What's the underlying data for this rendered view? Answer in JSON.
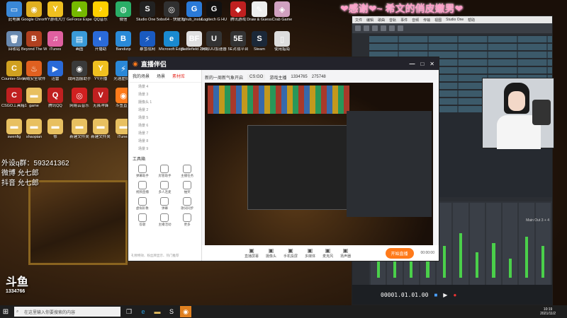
{
  "desktop": {
    "icons": [
      {
        "label": "此电脑",
        "color": "#3a88d8",
        "glyph": "▭"
      },
      {
        "label": "Google Chrome",
        "color": "#e0b020",
        "glyph": "◉"
      },
      {
        "label": "YY游戏大厅",
        "color": "#f0c020",
        "glyph": "Y"
      },
      {
        "label": "GeForce Experience",
        "color": "#76b900",
        "glyph": "▲"
      },
      {
        "label": "QQ音乐",
        "color": "#ffd000",
        "glyph": "♪"
      },
      {
        "label": "微信",
        "color": "#2aae67",
        "glyph": "◍"
      },
      {
        "label": "Studio One 5",
        "color": "#222",
        "glyph": "S"
      },
      {
        "label": "obs64 - 快捷方式",
        "color": "#303030",
        "glyph": "◎"
      },
      {
        "label": "lghub_instal...",
        "color": "#2a7ad8",
        "glyph": "G"
      },
      {
        "label": "Logitech G HUB",
        "color": "#111",
        "glyph": "G"
      },
      {
        "label": "腾讯游戏",
        "color": "#c02020",
        "glyph": "◆"
      },
      {
        "label": "Draw & Guess",
        "color": "#eee",
        "glyph": "✎"
      },
      {
        "label": "Crab Game",
        "color": "#d0a0c0",
        "glyph": "◈"
      },
      {
        "label": "回收站",
        "color": "#6a8ab0",
        "glyph": "🗑"
      },
      {
        "label": "Beyond The Wire Soun...",
        "color": "#b04020",
        "glyph": "B"
      },
      {
        "label": "iTunes",
        "color": "#e060a0",
        "glyph": "♫"
      },
      {
        "label": "画图",
        "color": "#3a9ad8",
        "glyph": "▤"
      },
      {
        "label": "开播助",
        "color": "#2a6ad8",
        "glyph": "◐"
      },
      {
        "label": "Bandizip",
        "color": "#2a8ad8",
        "glyph": "B"
      },
      {
        "label": "暴雪战网",
        "color": "#1a5ac0",
        "glyph": "⚡"
      },
      {
        "label": "Microsoft Edge",
        "color": "#1a8ad0",
        "glyph": "e"
      },
      {
        "label": "Battlefield 2042 Open...",
        "color": "#e0e0e0",
        "glyph": "BF"
      },
      {
        "label": "网易UU加速器",
        "color": "#333",
        "glyph": "U"
      },
      {
        "label": "5E对战平台",
        "color": "#333",
        "glyph": "5E"
      },
      {
        "label": "Steam",
        "color": "#1b2838",
        "glyph": "S"
      },
      {
        "label": "使用指南",
        "color": "#ddd",
        "glyph": "▯"
      },
      {
        "label": "Counter-Strike Global Off...",
        "color": "#d0a020",
        "glyph": "C"
      },
      {
        "label": "火绒安全软件",
        "color": "#e06020",
        "glyph": "♨"
      },
      {
        "label": "迅雷",
        "color": "#2a6ad8",
        "glyph": "▶"
      },
      {
        "label": "战网国服助手",
        "color": "#3a3a3a",
        "glyph": "◉"
      },
      {
        "label": "YY开播",
        "color": "#f0c020",
        "glyph": "Y"
      },
      {
        "label": "光速虚拟机",
        "color": "#2a88d8",
        "glyph": "⚡"
      },
      {
        "label": "CSGO工具箱1.0.2",
        "color": "#c02020",
        "glyph": "C"
      },
      {
        "label": "game",
        "color": "#e8c060",
        "glyph": "▬"
      },
      {
        "label": "腾讯QQ",
        "color": "#c02020",
        "glyph": "Q"
      },
      {
        "label": "网易云音乐",
        "color": "#d02020",
        "glyph": "◎"
      },
      {
        "label": "无畏冲锋",
        "color": "#c02020",
        "glyph": "V"
      },
      {
        "label": "斗鱼直播",
        "color": "#ff7a1a",
        "glyph": "◉"
      },
      {
        "label": "swenfig",
        "color": "#e8c060",
        "glyph": "▬"
      },
      {
        "label": "shaopian",
        "color": "#e8c060",
        "glyph": "▬"
      },
      {
        "label": "修",
        "color": "#e8c060",
        "glyph": "▬"
      },
      {
        "label": "新建文件夹",
        "color": "#e8c060",
        "glyph": "▬"
      },
      {
        "label": "新建文件夹",
        "color": "#e8c060",
        "glyph": "▬"
      },
      {
        "label": "iTunes",
        "color": "#e8c060",
        "glyph": "▬"
      }
    ],
    "overlay": {
      "qq_line": "外设q群：593241362",
      "weibo_line": "微博    允七郎",
      "douyin_line": "抖音    允七郎"
    },
    "banner": "❤感谢❤~ 希文的俏皮嫩男❤",
    "watermark_name": "斗鱼",
    "watermark_id": "1334766"
  },
  "streamer": {
    "app_name": "直播伴侣",
    "tabs": [
      "我的场景",
      "场景",
      "素材库"
    ],
    "active_tab": "素材库",
    "scenes": [
      "场景 4",
      "场景 3",
      "摄像头 1",
      "场景 2",
      "场景 5",
      "场景 6",
      "场景 7",
      "场景 8",
      "场景 9"
    ],
    "tools_title": "工具箱",
    "tools": [
      "弹幕助手",
      "房管助手",
      "主播任务",
      "视频直播",
      "多人连麦",
      "抽奖",
      "虚拟形象",
      "弹幕",
      "歌词同步",
      "答题",
      "主播活动",
      "更多"
    ],
    "room_title": "新的一周新气象开启",
    "game": "CS:GO",
    "category": "游戏主播",
    "stat_a": "1334765",
    "stat_b": "275748",
    "bottom_labels": [
      "直播屏幕",
      "摄像头",
      "手机投屏",
      "多媒体",
      "麦克风",
      "扬声器"
    ],
    "live_button": "开始直播",
    "timer": "00:00:00",
    "notice": "礼物特效、粉丝牌显示、热门推荐"
  },
  "daw": {
    "menu": [
      "文件",
      "编辑",
      "歌曲",
      "音轨",
      "事件",
      "音频",
      "传输",
      "视图",
      "Studio One",
      "帮助"
    ],
    "timecode": "00001.01.01.00",
    "mixer_levels": [
      0.35,
      0.55,
      0.45,
      0.6,
      0.5,
      0.7,
      0.4,
      0.55,
      0.3,
      0.65,
      0.5
    ],
    "master_label": "Main Out 3 + 4"
  },
  "taskbar": {
    "search_placeholder": "在这里输入你要搜索的内容",
    "time": "10:19",
    "date": "2021/11/2"
  }
}
